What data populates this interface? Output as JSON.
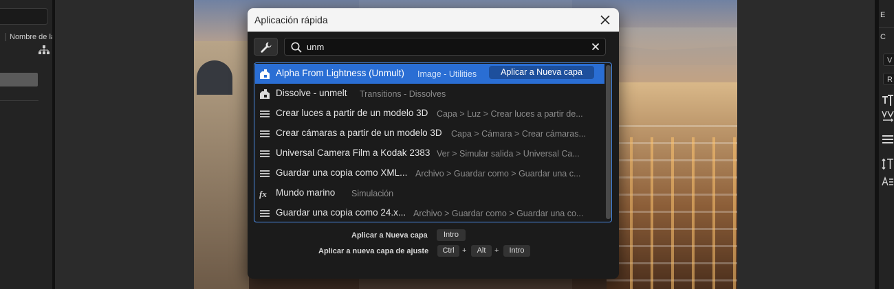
{
  "left_panel": {
    "column_header": "Nombre de la"
  },
  "right_panel": {
    "items": [
      "E",
      "C",
      "V",
      "R"
    ],
    "icons": [
      "text-size-icon",
      "tracking-icon",
      "align-icon",
      "leading-icon",
      "baseline-icon"
    ]
  },
  "dialog": {
    "title": "Aplicación rápida",
    "search": {
      "value": "unm",
      "placeholder": ""
    },
    "results": [
      {
        "name": "Alpha From Lightness (Unmult)",
        "category": "Image - Utilities",
        "icon": "plugin-effect-icon",
        "selected": true,
        "apply_label": "Aplicar a Nueva capa"
      },
      {
        "name": "Dissolve - unmelt",
        "category": "Transitions - Dissolves",
        "icon": "plugin-effect-icon"
      },
      {
        "name": "Crear luces a partir de un modelo 3D",
        "category": "Capa > Luz > Crear luces a partir de...",
        "icon": "menu-command-icon"
      },
      {
        "name": "Crear cámaras a partir de un modelo 3D",
        "category": "Capa > Cámara > Crear cámaras...",
        "icon": "menu-command-icon"
      },
      {
        "name": "Universal Camera Film a Kodak 2383",
        "category": "Ver > Simular salida > Universal Ca...",
        "icon": "menu-command-icon"
      },
      {
        "name": "Guardar una copia como XML...",
        "category": "Archivo > Guardar como > Guardar una c...",
        "icon": "menu-command-icon"
      },
      {
        "name": "Mundo marino",
        "category": "Simulación",
        "icon": "fx-icon"
      },
      {
        "name": "Guardar una copia como 24.x...",
        "category": "Archivo > Guardar como > Guardar una co...",
        "icon": "menu-command-icon"
      }
    ],
    "shortcuts": [
      {
        "label": "Aplicar a Nueva capa",
        "keys": [
          "Intro"
        ]
      },
      {
        "label": "Aplicar a nueva capa de ajuste",
        "keys": [
          "Ctrl",
          "Alt",
          "Intro"
        ]
      }
    ],
    "plus_sign": "+"
  }
}
